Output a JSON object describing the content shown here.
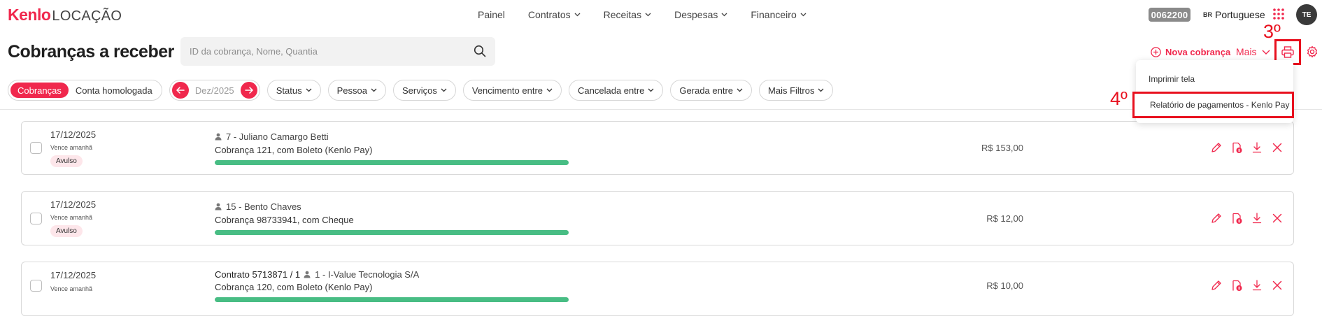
{
  "brand": {
    "name": "Kenlo",
    "product": "LOCAÇÃO",
    "accent": "#f0284d"
  },
  "nav": {
    "items": [
      {
        "label": "Painel",
        "has_dropdown": false
      },
      {
        "label": "Contratos",
        "has_dropdown": true
      },
      {
        "label": "Receitas",
        "has_dropdown": true
      },
      {
        "label": "Despesas",
        "has_dropdown": true
      },
      {
        "label": "Financeiro",
        "has_dropdown": true
      }
    ]
  },
  "header": {
    "tenant_code": "0062200",
    "language_flag": "BR",
    "language": "Portuguese",
    "user_initials": "TE"
  },
  "page": {
    "title": "Cobranças a receber"
  },
  "search": {
    "placeholder": "ID da cobrança, Nome, Quantia",
    "value": ""
  },
  "actions": {
    "new_charge": "Nova cobrança",
    "more": "Mais"
  },
  "annotations": {
    "step3": "3º",
    "step4": "4º",
    "highlight_color": "#e8101e"
  },
  "menu": {
    "items": [
      "Imprimir tela",
      "Relatório de pagamentos - Kenlo Pay"
    ]
  },
  "filters": {
    "tabs": [
      "Cobranças",
      "Conta homologada"
    ],
    "active_tab": "Cobranças",
    "month": "Dez/2025",
    "chips": [
      "Status",
      "Pessoa",
      "Serviços",
      "Vencimento entre",
      "Cancelada entre",
      "Gerada entre",
      "Mais Filtros"
    ]
  },
  "charges": [
    {
      "date": "17/12/2025",
      "due_note": "Vence amanhã",
      "tag": "Avulso",
      "contract": "",
      "person": "7 - Juliano Camargo Betti",
      "description": "Cobrança 121, com Boleto (Kenlo Pay)",
      "amount": "R$ 153,00",
      "progress": 1.0
    },
    {
      "date": "17/12/2025",
      "due_note": "Vence amanhã",
      "tag": "Avulso",
      "contract": "",
      "person": "15 - Bento Chaves",
      "description": "Cobrança 98733941, com Cheque",
      "amount": "R$ 12,00",
      "progress": 1.0
    },
    {
      "date": "17/12/2025",
      "due_note": "Vence amanhã",
      "tag": "",
      "contract": "Contrato 5713871 / 1",
      "person": "1 - I-Value Tecnologia S/A",
      "description": "Cobrança 120, com Boleto (Kenlo Pay)",
      "amount": "R$ 10,00",
      "progress": 1.0
    }
  ],
  "row_action_icons": [
    "edit-icon",
    "receipt-money-icon",
    "download-icon",
    "close-icon"
  ],
  "colors": {
    "progress": "#48bd84",
    "tag_bg": "#fde6ea",
    "tenant_badge": "#8a8a8a"
  }
}
